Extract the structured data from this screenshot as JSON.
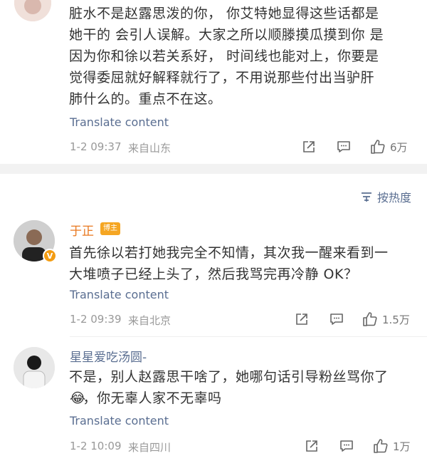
{
  "comments": [
    {
      "text": "脏水不是赵露思泼的你， 你艾特她显得这些话都是\n她干的 会引人误解。大家之所以顺滕摸瓜摸到你 是\n因为你和徐以若关系好， 时间线也能对上，你要是\n觉得委屈就好解释就行了，不用说那些付出当驴肝\n肺什么的。重点不在这。",
      "translate": "Translate content",
      "time": "1-2 09:37",
      "location": "来自山东",
      "likes": "6万"
    },
    {
      "username": "于正",
      "badge": "博主",
      "verified": "V",
      "text": "首先徐以若打她我完全不知情，其次我一醒来看到一\n大堆喷子已经上头了，然后我骂完再冷静 OK？",
      "translate": "Translate content",
      "time": "1-2 09:39",
      "location": "来自北京",
      "likes": "1.5万"
    },
    {
      "username": "星星爱吃汤圆-",
      "text": "不是，别人赵露思干啥了，她哪句话引导粉丝骂你了\n　，你无辜人家不无辜吗",
      "emoji": "😂",
      "translate": "Translate content",
      "time": "1-2 10:09",
      "location": "来自四川",
      "likes": "1万"
    }
  ],
  "sort": {
    "label": "按热度"
  },
  "colors": {
    "link": "#5a6e91",
    "username": "#e8771e",
    "meta": "#999999",
    "divider": "#f2f2f2"
  }
}
